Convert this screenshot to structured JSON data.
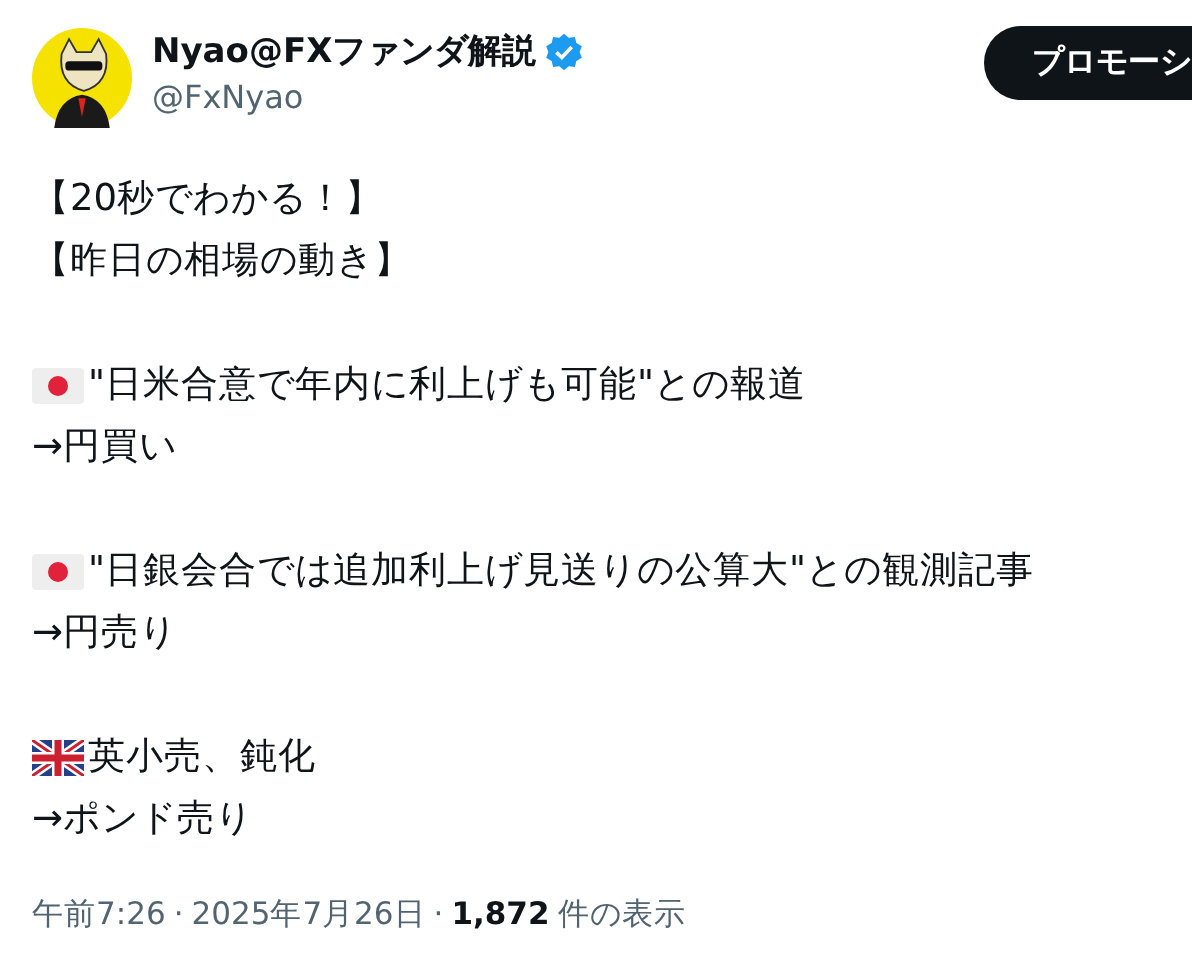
{
  "author": {
    "name": "Nyao@FXファンダ解説",
    "handle": "@FxNyao",
    "verified": true
  },
  "promote_button": {
    "label": "プロモーシ"
  },
  "paragraphs": [
    [
      {
        "kind": "plain",
        "text": "【20秒でわかる！】"
      },
      {
        "kind": "plain",
        "text": "【昨日の相場の動き】"
      }
    ],
    [
      {
        "kind": "jp_flag",
        "text": "\"日米合意で年内に利上げも可能\"との報道"
      },
      {
        "kind": "plain",
        "text": "→円買い"
      }
    ],
    [
      {
        "kind": "jp_flag",
        "text": "\"日銀会合では追加利上げ見送りの公算大\"との観測記事"
      },
      {
        "kind": "plain",
        "text": "→円売り"
      }
    ],
    [
      {
        "kind": "uk_flag",
        "text": "英小売、鈍化"
      },
      {
        "kind": "plain",
        "text": "→ポンド売り"
      }
    ]
  ],
  "meta": {
    "time": "午前7:26",
    "sep_1": "·",
    "date": "2025年7月26日",
    "sep_2": "·",
    "views": "1,872",
    "views_label": "件の表示"
  }
}
